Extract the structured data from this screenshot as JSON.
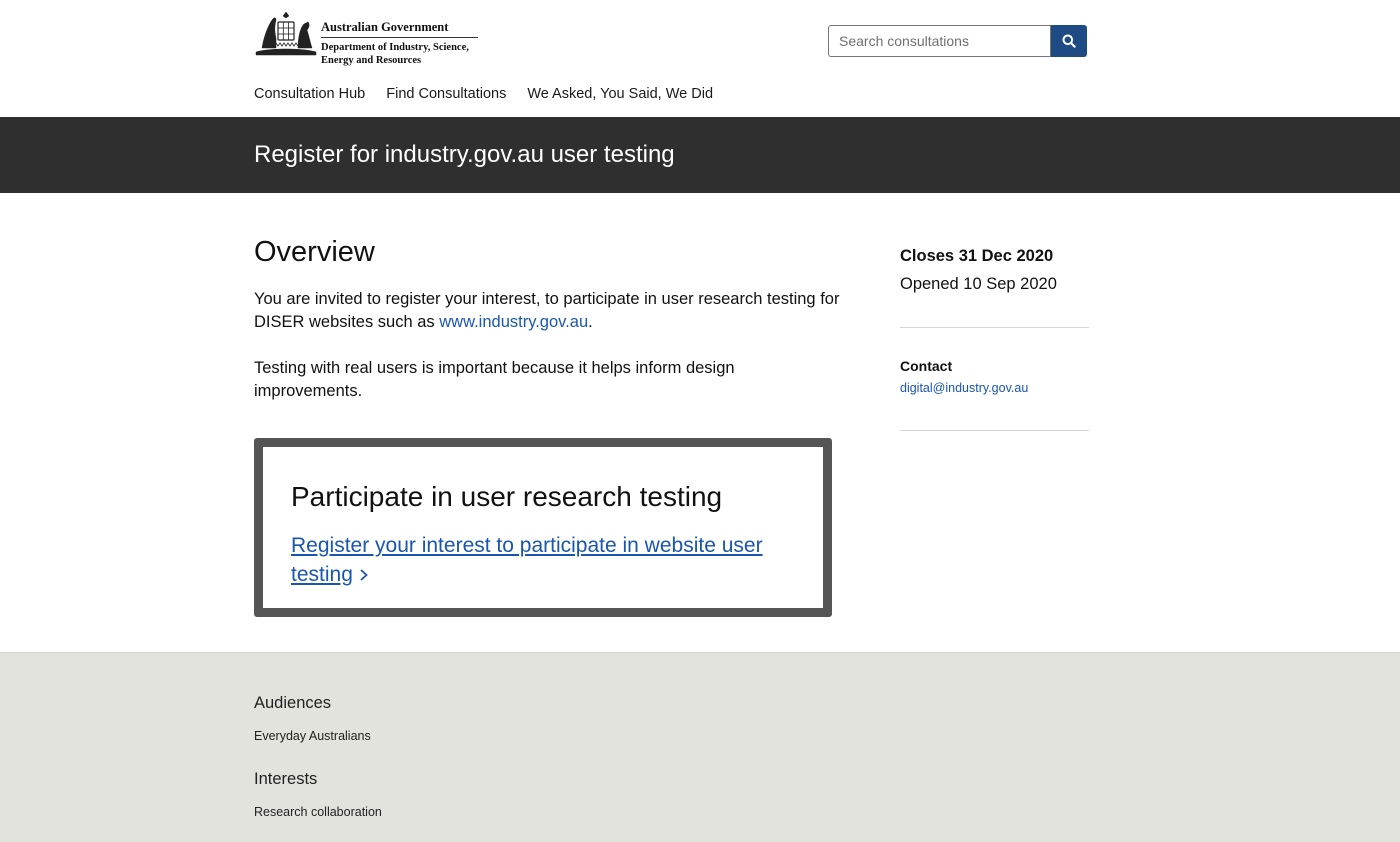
{
  "header": {
    "government_name": "Australian Government",
    "department_name": "Department of Industry, Science,\nEnergy and Resources",
    "search": {
      "placeholder": "Search consultations",
      "value": ""
    }
  },
  "nav": {
    "items": [
      {
        "label": "Consultation Hub"
      },
      {
        "label": "Find Consultations"
      },
      {
        "label": "We Asked, You Said, We Did"
      }
    ]
  },
  "page": {
    "title": "Register for industry.gov.au user testing"
  },
  "overview": {
    "heading": "Overview",
    "para1_text": "You are invited to register your interest, to participate in user research testing for DISER websites such as ",
    "para1_link": "www.industry.gov.au",
    "para1_end": ".",
    "para2": "Testing with real users is important because it helps inform design improvements."
  },
  "cta": {
    "heading": "Participate in user research testing",
    "link_label": "Register your interest to participate in website user testing"
  },
  "sidebar": {
    "closes": "Closes 31 Dec 2020",
    "opened": "Opened 10 Sep 2020",
    "contact_label": "Contact",
    "contact_email": "digital@industry.gov.au"
  },
  "footer": {
    "audiences_heading": "Audiences",
    "audiences_item": "Everyday Australians",
    "interests_heading": "Interests",
    "interests_item": "Research collaboration"
  },
  "colors": {
    "link": "#1a56b0",
    "search_button": "#1e4b84",
    "title_band": "#2f2f2f",
    "footer_bg": "#e3e3de"
  },
  "icons": {
    "search_button": "search-icon",
    "logo": "coat-of-arms-icon",
    "cta_link": "chevron-right-icon"
  }
}
